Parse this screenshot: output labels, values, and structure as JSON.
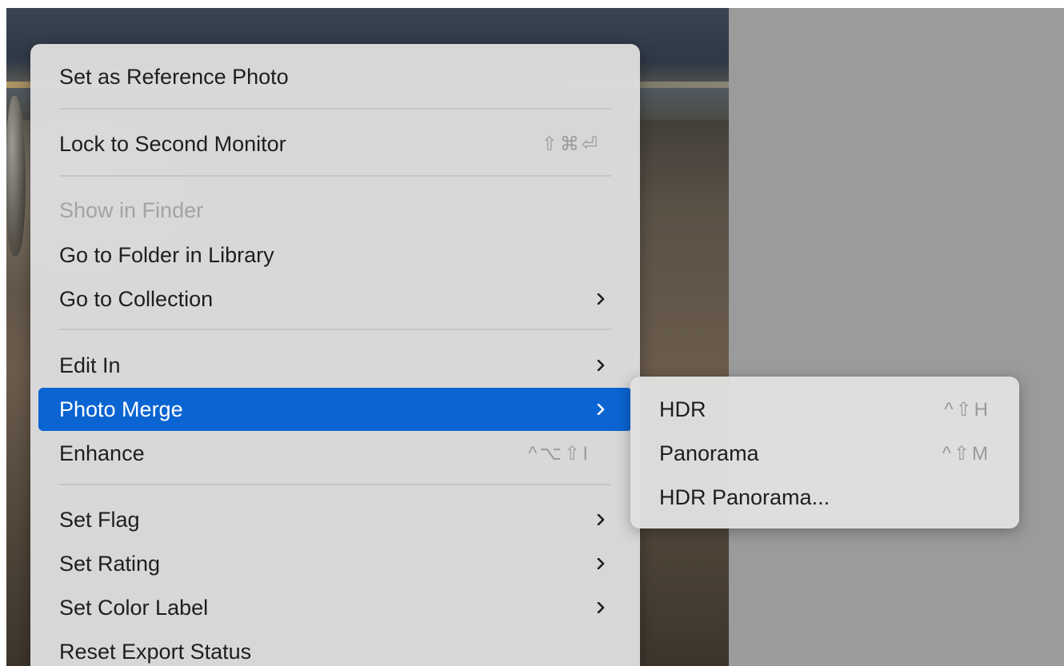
{
  "menu": {
    "items": [
      {
        "label": "Set as Reference Photo"
      },
      {
        "label": "Lock to Second Monitor",
        "shortcut": "⇧⌘⏎"
      },
      {
        "label": "Show in Finder"
      },
      {
        "label": "Go to Folder in Library"
      },
      {
        "label": "Go to Collection"
      },
      {
        "label": "Edit In"
      },
      {
        "label": "Photo Merge"
      },
      {
        "label": "Enhance",
        "shortcut": "^⌥⇧I"
      },
      {
        "label": "Set Flag"
      },
      {
        "label": "Set Rating"
      },
      {
        "label": "Set Color Label"
      },
      {
        "label": "Reset Export Status"
      }
    ]
  },
  "submenu": {
    "items": [
      {
        "label": "HDR",
        "shortcut": "^⇧H"
      },
      {
        "label": "Panorama",
        "shortcut": "^⇧M"
      },
      {
        "label": "HDR Panorama..."
      }
    ]
  },
  "colors": {
    "selection": "#0a64d2",
    "menu_bg": "#dedede",
    "disabled_text": "#a3a3a3"
  },
  "icons": {
    "submenu_indicator": "chevron-right-icon"
  }
}
